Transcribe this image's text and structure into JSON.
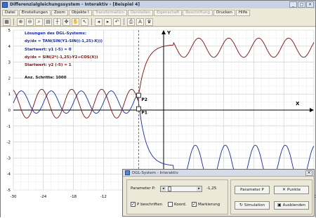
{
  "window": {
    "title": "Differenzialgleichungssystem - Interaktiv - [Beispiel 4]",
    "controls": [
      "_",
      "□",
      "×"
    ]
  },
  "menu": [
    {
      "label": "Datei",
      "enabled": true
    },
    {
      "label": "Einstellungen",
      "enabled": true
    },
    {
      "label": "Zoom",
      "enabled": true
    },
    {
      "label": "Objekte I",
      "enabled": true
    },
    {
      "label": "Transformation",
      "enabled": false
    },
    {
      "label": "Darstellen",
      "enabled": false
    },
    {
      "label": "Eigenschaft",
      "enabled": false
    },
    {
      "label": "Beschriftung",
      "enabled": false
    },
    {
      "label": "Drucken",
      "enabled": true
    },
    {
      "label": "Hilfe",
      "enabled": true
    }
  ],
  "toolbar_icons": [
    "calculator-icon",
    "zoom-in-icon",
    "zoom-out-icon",
    "zoom-window-icon",
    "grid-icon",
    "axes-icon",
    "move-icon",
    "pan-icon",
    "cursor-icon",
    "arrow-left-icon",
    "arrow-right-icon",
    "undo-icon",
    "print-icon",
    "font-icon",
    "trophy-icon"
  ],
  "info": {
    "heading": "Lösungen des DGL-Systems:",
    "eq1": "dy/dx = TAN(SIN(Y1-SIN((-1,25)-X)))",
    "start1": "Startwert: y1 (-5) = 0",
    "eq2": "dy/dx = SIN(2*(-1,25)-Y2+COS(X))",
    "start2": "Startwert: y2 (-5) = 1",
    "steps": "Anz. Schritte: 1000"
  },
  "axes": {
    "x_label": "X",
    "y_label": "Y",
    "x_ticks": [
      "-30",
      "-24",
      "-18",
      "-12",
      "-6",
      "6",
      "12",
      "18",
      "24",
      "30"
    ],
    "y_ticks": [
      "5",
      "4",
      "3",
      "2",
      "1",
      "0",
      "-1",
      "-2",
      "-3",
      "-4",
      "-5"
    ],
    "x_range": [
      -30,
      30
    ],
    "y_range": [
      -5,
      5
    ]
  },
  "points": {
    "p1": "P1",
    "p2": "P2"
  },
  "colors": {
    "curve1": "#1a2a9a",
    "curve2": "#7a1010",
    "eq1": "#1a2a9a",
    "eq2": "#7a1010"
  },
  "dialog": {
    "title": "DGL-System - Interaktiv",
    "param_label": "Parameter P:",
    "param_value": "-1,25",
    "cb_p_label": "P beschriften",
    "cb_p_checked": true,
    "cb_koord": "Koord.",
    "cb_koord_checked": false,
    "cb_mark": "Markierung",
    "cb_mark_checked": true,
    "btn_param": "Parameter P",
    "btn_points": "Punkte",
    "btn_sim": "Simulation",
    "btn_hide": "Ausblenden"
  }
}
